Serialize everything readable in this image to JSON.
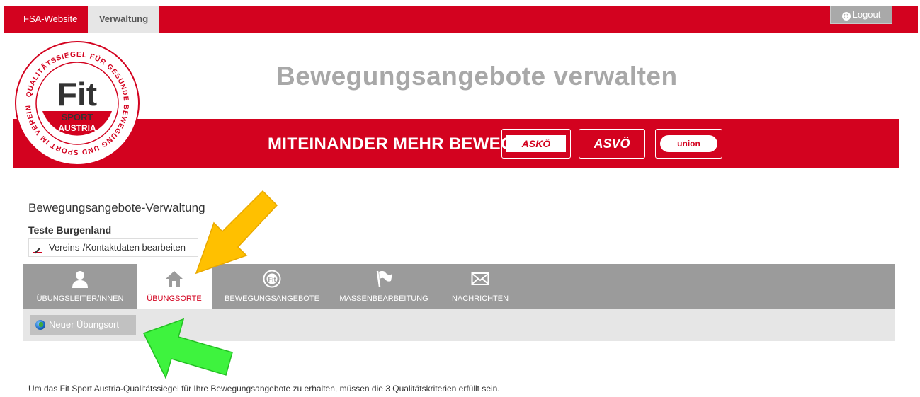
{
  "topbar": {
    "tab_site": "FSA-Website",
    "tab_admin": "Verwaltung",
    "logout_label": "Logout"
  },
  "header": {
    "title": "Bewegungsangebote verwalten",
    "slogan": "MITEINANDER MEHR BEWEGEN.",
    "partners": [
      "ASKÖ",
      "ASVÖ",
      "union"
    ]
  },
  "logo": {
    "ring_text": "QUALITÄTSSIEGEL FÜR GESUNDE BEWEGUNG UND SPORT IM VEREIN",
    "center_text": "Fit",
    "sport": "SPORT",
    "austria": "AUSTRIA"
  },
  "content": {
    "section_title": "Bewegungsangebote-Verwaltung",
    "org_name": "Teste Burgenland",
    "edit_link": "Vereins-/Kontaktdaten bearbeiten"
  },
  "nav": {
    "items": [
      {
        "label": "ÜBUNGSLEITER/INNEN",
        "icon": "person-icon"
      },
      {
        "label": "ÜBUNGSORTE",
        "icon": "home-icon"
      },
      {
        "label": "BEWEGUNGSANGEBOTE",
        "icon": "fit-logo-icon"
      },
      {
        "label": "MASSENBEARBEITUNG",
        "icon": "flag-icon"
      },
      {
        "label": "NACHRICHTEN",
        "icon": "envelope-icon"
      }
    ],
    "active_index": 1
  },
  "toolbar": {
    "new_location_label": "Neuer Übungsort"
  },
  "footer_text": {
    "before": "Um das Fit Sport Austria-Qualitätssiegel für Ihre Bewegungsangebote zu erhalten, müssen die ",
    "link": "3 Qualitätskriterien",
    "after": " erfüllt sein."
  },
  "colors": {
    "brand_red": "#d3021f",
    "nav_gray": "#9b9b9b",
    "arrow_yellow": "#ffc000",
    "arrow_green": "#3ef33e"
  }
}
